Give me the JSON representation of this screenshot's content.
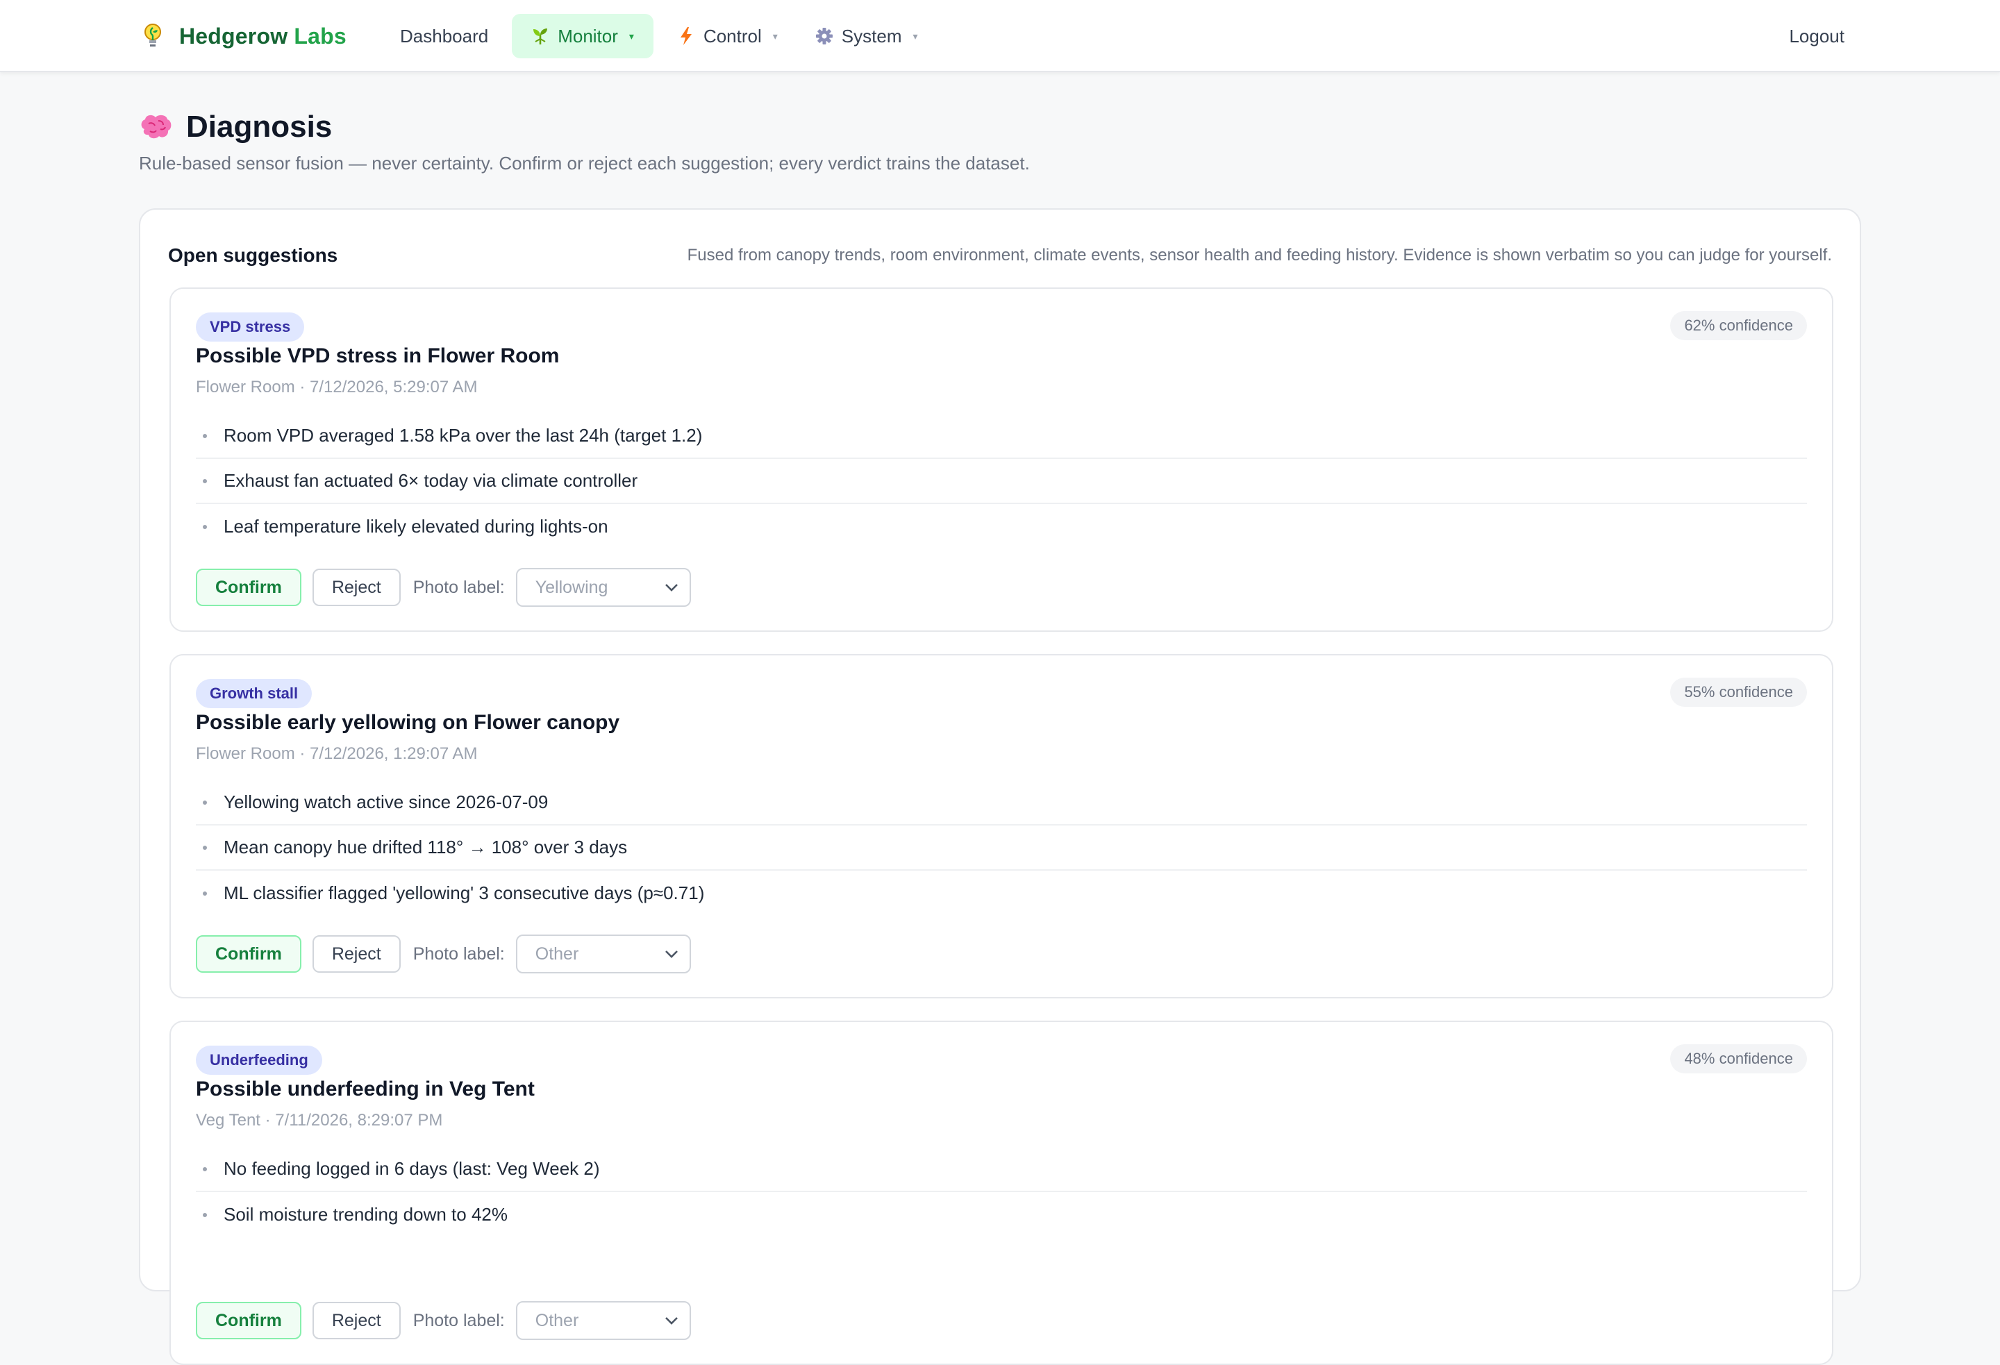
{
  "brand": {
    "name_main": "Hedgerow",
    "name_accent": "Labs"
  },
  "nav": {
    "dashboard": "Dashboard",
    "monitor": "Monitor",
    "control": "Control",
    "system": "System",
    "caret": "▾",
    "logout": "Logout"
  },
  "page": {
    "title": "Diagnosis",
    "subtitle": "Rule-based sensor fusion — never certainty. Confirm or reject each suggestion; every verdict trains the dataset."
  },
  "panel": {
    "title": "Open suggestions",
    "description": "Fused from canopy trends, room environment, climate events, sensor health and feeding history. Evidence is shown verbatim so you can judge for yourself."
  },
  "suggestions": [
    {
      "tag": "VPD stress",
      "confidence": "62% confidence",
      "title": "Possible VPD stress in Flower Room",
      "meta": "Flower Room · 7/12/2026, 5:29:07 AM",
      "evidence": [
        "Room VPD averaged 1.58 kPa over the last 24h (target 1.2)",
        "Exhaust fan actuated 6× today via climate controller",
        "Leaf temperature likely elevated during lights-on"
      ],
      "confirm": "Confirm",
      "reject": "Reject",
      "photo_label": "Photo label:",
      "photo_value": "Yellowing"
    },
    {
      "tag": "Growth stall",
      "confidence": "55% confidence",
      "title": "Possible early yellowing on Flower canopy",
      "meta": "Flower Room · 7/12/2026, 1:29:07 AM",
      "evidence": [
        "Yellowing watch active since 2026-07-09",
        "Mean canopy hue drifted 118° → 108° over 3 days",
        "ML classifier flagged 'yellowing' 3 consecutive days (p≈0.71)"
      ],
      "confirm": "Confirm",
      "reject": "Reject",
      "photo_label": "Photo label:",
      "photo_value": "Other"
    },
    {
      "tag": "Underfeeding",
      "confidence": "48% confidence",
      "title": "Possible underfeeding in Veg Tent",
      "meta": "Veg Tent · 7/11/2026, 8:29:07 PM",
      "evidence": [
        "No feeding logged in 6 days (last: Veg Week 2)",
        "Soil moisture trending down to 42%"
      ],
      "confirm": "Confirm",
      "reject": "Reject",
      "photo_label": "Photo label:",
      "photo_value": "Other"
    }
  ],
  "icons": {
    "brand": "lightbulb-icon",
    "monitor": "sprout-icon",
    "control": "lightning-icon",
    "system": "gear-icon",
    "page": "brain-icon"
  },
  "colors": {
    "brand_dark": "#166534",
    "brand_accent": "#22a34a",
    "active_nav_bg": "#dcfce7",
    "tag_bg": "#e0e7ff",
    "tag_text": "#3730a3",
    "confirm_border": "#86efac"
  }
}
